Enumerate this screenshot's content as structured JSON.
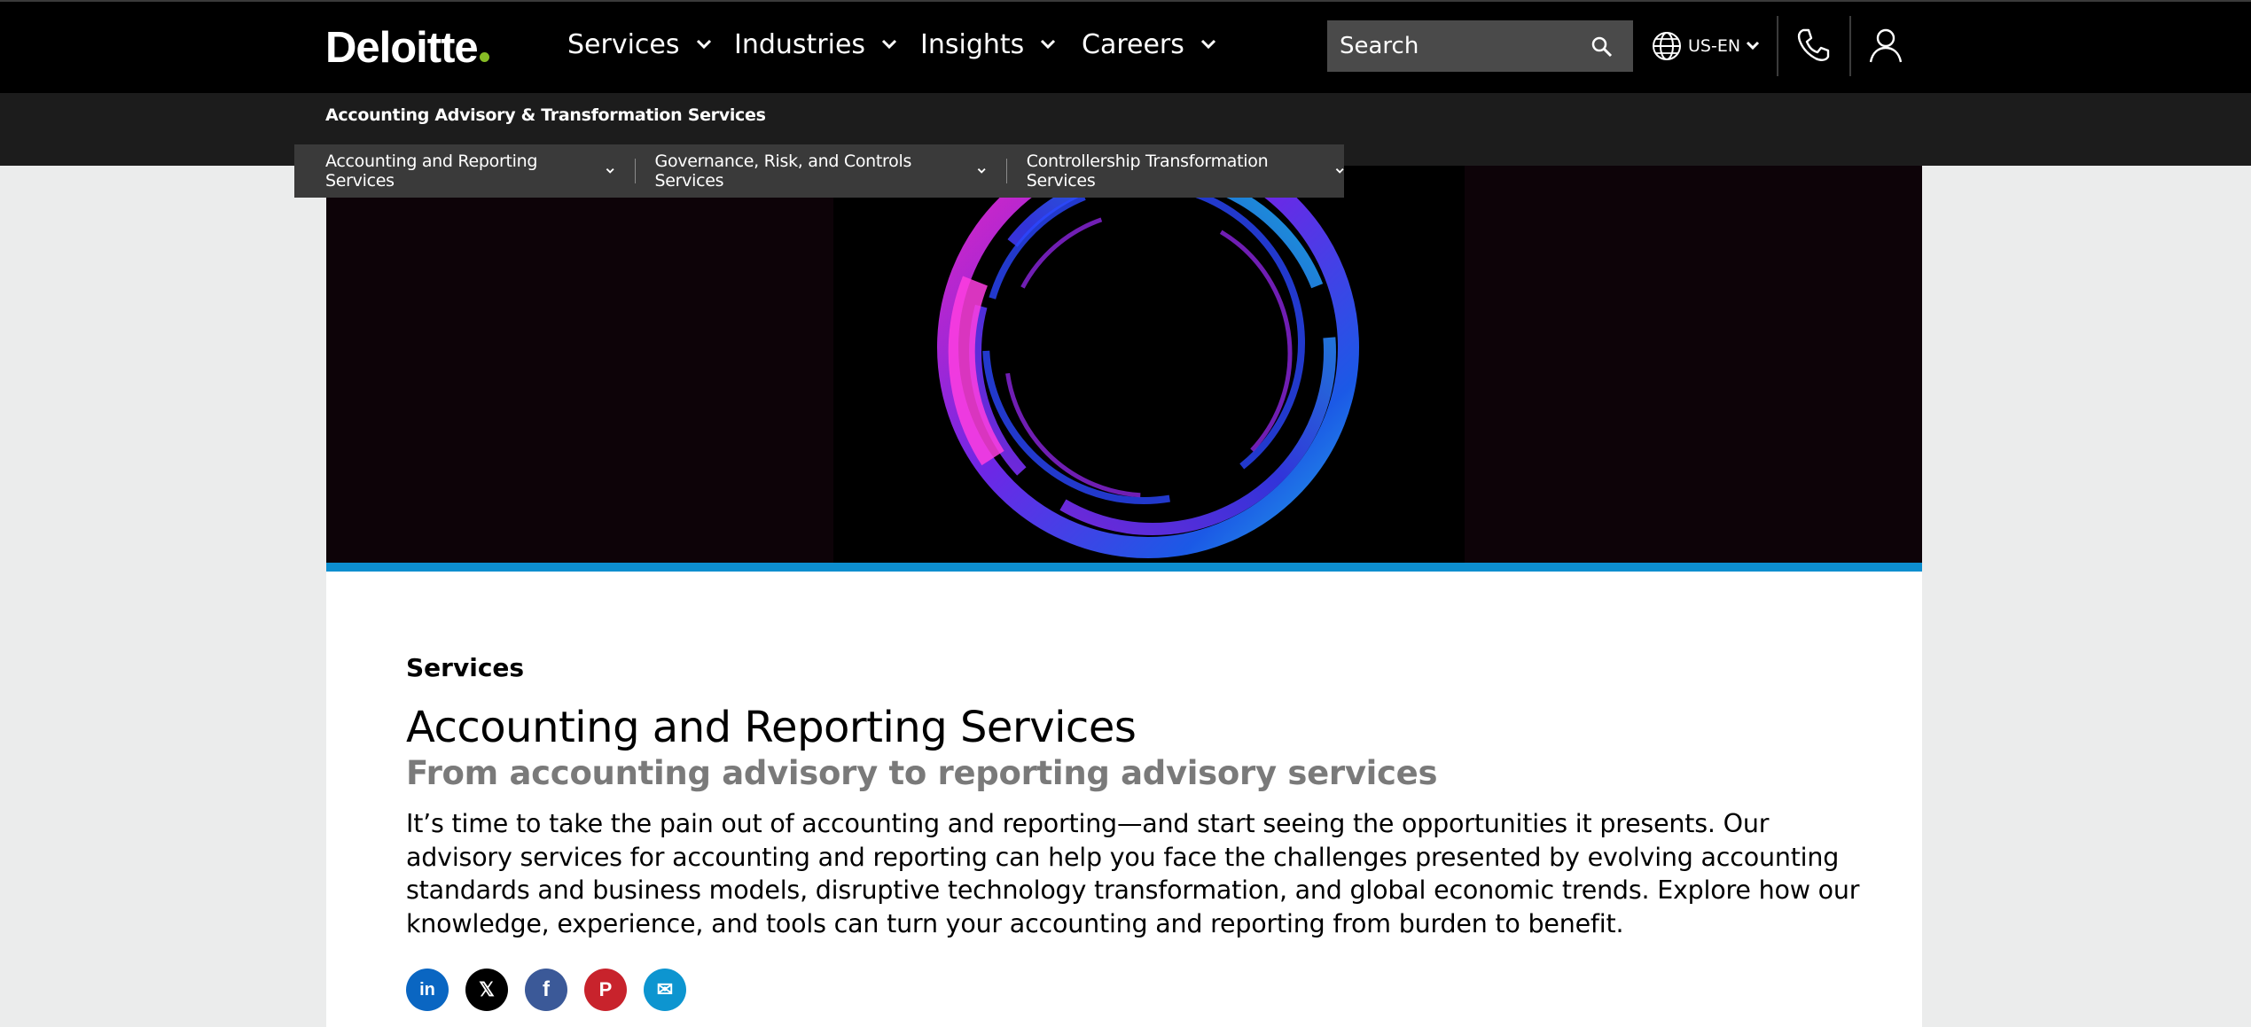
{
  "brand": {
    "logo_text": "Deloitte",
    "accent_color": "#86bc25"
  },
  "topnav": {
    "items": [
      {
        "label": "Services"
      },
      {
        "label": "Industries"
      },
      {
        "label": "Insights"
      },
      {
        "label": "Careers"
      }
    ],
    "search_placeholder": "Search",
    "locale": "US-EN"
  },
  "subnav": {
    "title": "Accounting Advisory & Transformation Services",
    "items": [
      {
        "label": "Accounting and Reporting Services"
      },
      {
        "label": "Governance, Risk, and Controls Services"
      },
      {
        "label": "Controllership Transformation Services"
      }
    ]
  },
  "content": {
    "eyebrow": "Services",
    "title": "Accounting and Reporting Services",
    "subtitle": "From accounting advisory to reporting advisory services",
    "body": "It’s time to take the pain out of accounting and reporting—and start seeing the opportunities it presents. Our advisory services for accounting and reporting can help you face the challenges presented by evolving accounting standards and business models, disruptive technology transformation, and global economic trends. Explore how our knowledge, experience, and tools can turn your accounting and reporting from burden to benefit."
  },
  "share": [
    {
      "icon": "linkedin-icon",
      "glyph": "in",
      "color": "#0a66c2"
    },
    {
      "icon": "x-icon",
      "glyph": "𝕏",
      "color": "#000000"
    },
    {
      "icon": "facebook-icon",
      "glyph": "f",
      "color": "#3b5998"
    },
    {
      "icon": "pinterest-icon",
      "glyph": "P",
      "color": "#c8232c"
    },
    {
      "icon": "email-icon",
      "glyph": "✉",
      "color": "#0d95d0"
    }
  ],
  "colors": {
    "hero_accent": "#0d8ecf",
    "page_bg": "#ebecec"
  }
}
